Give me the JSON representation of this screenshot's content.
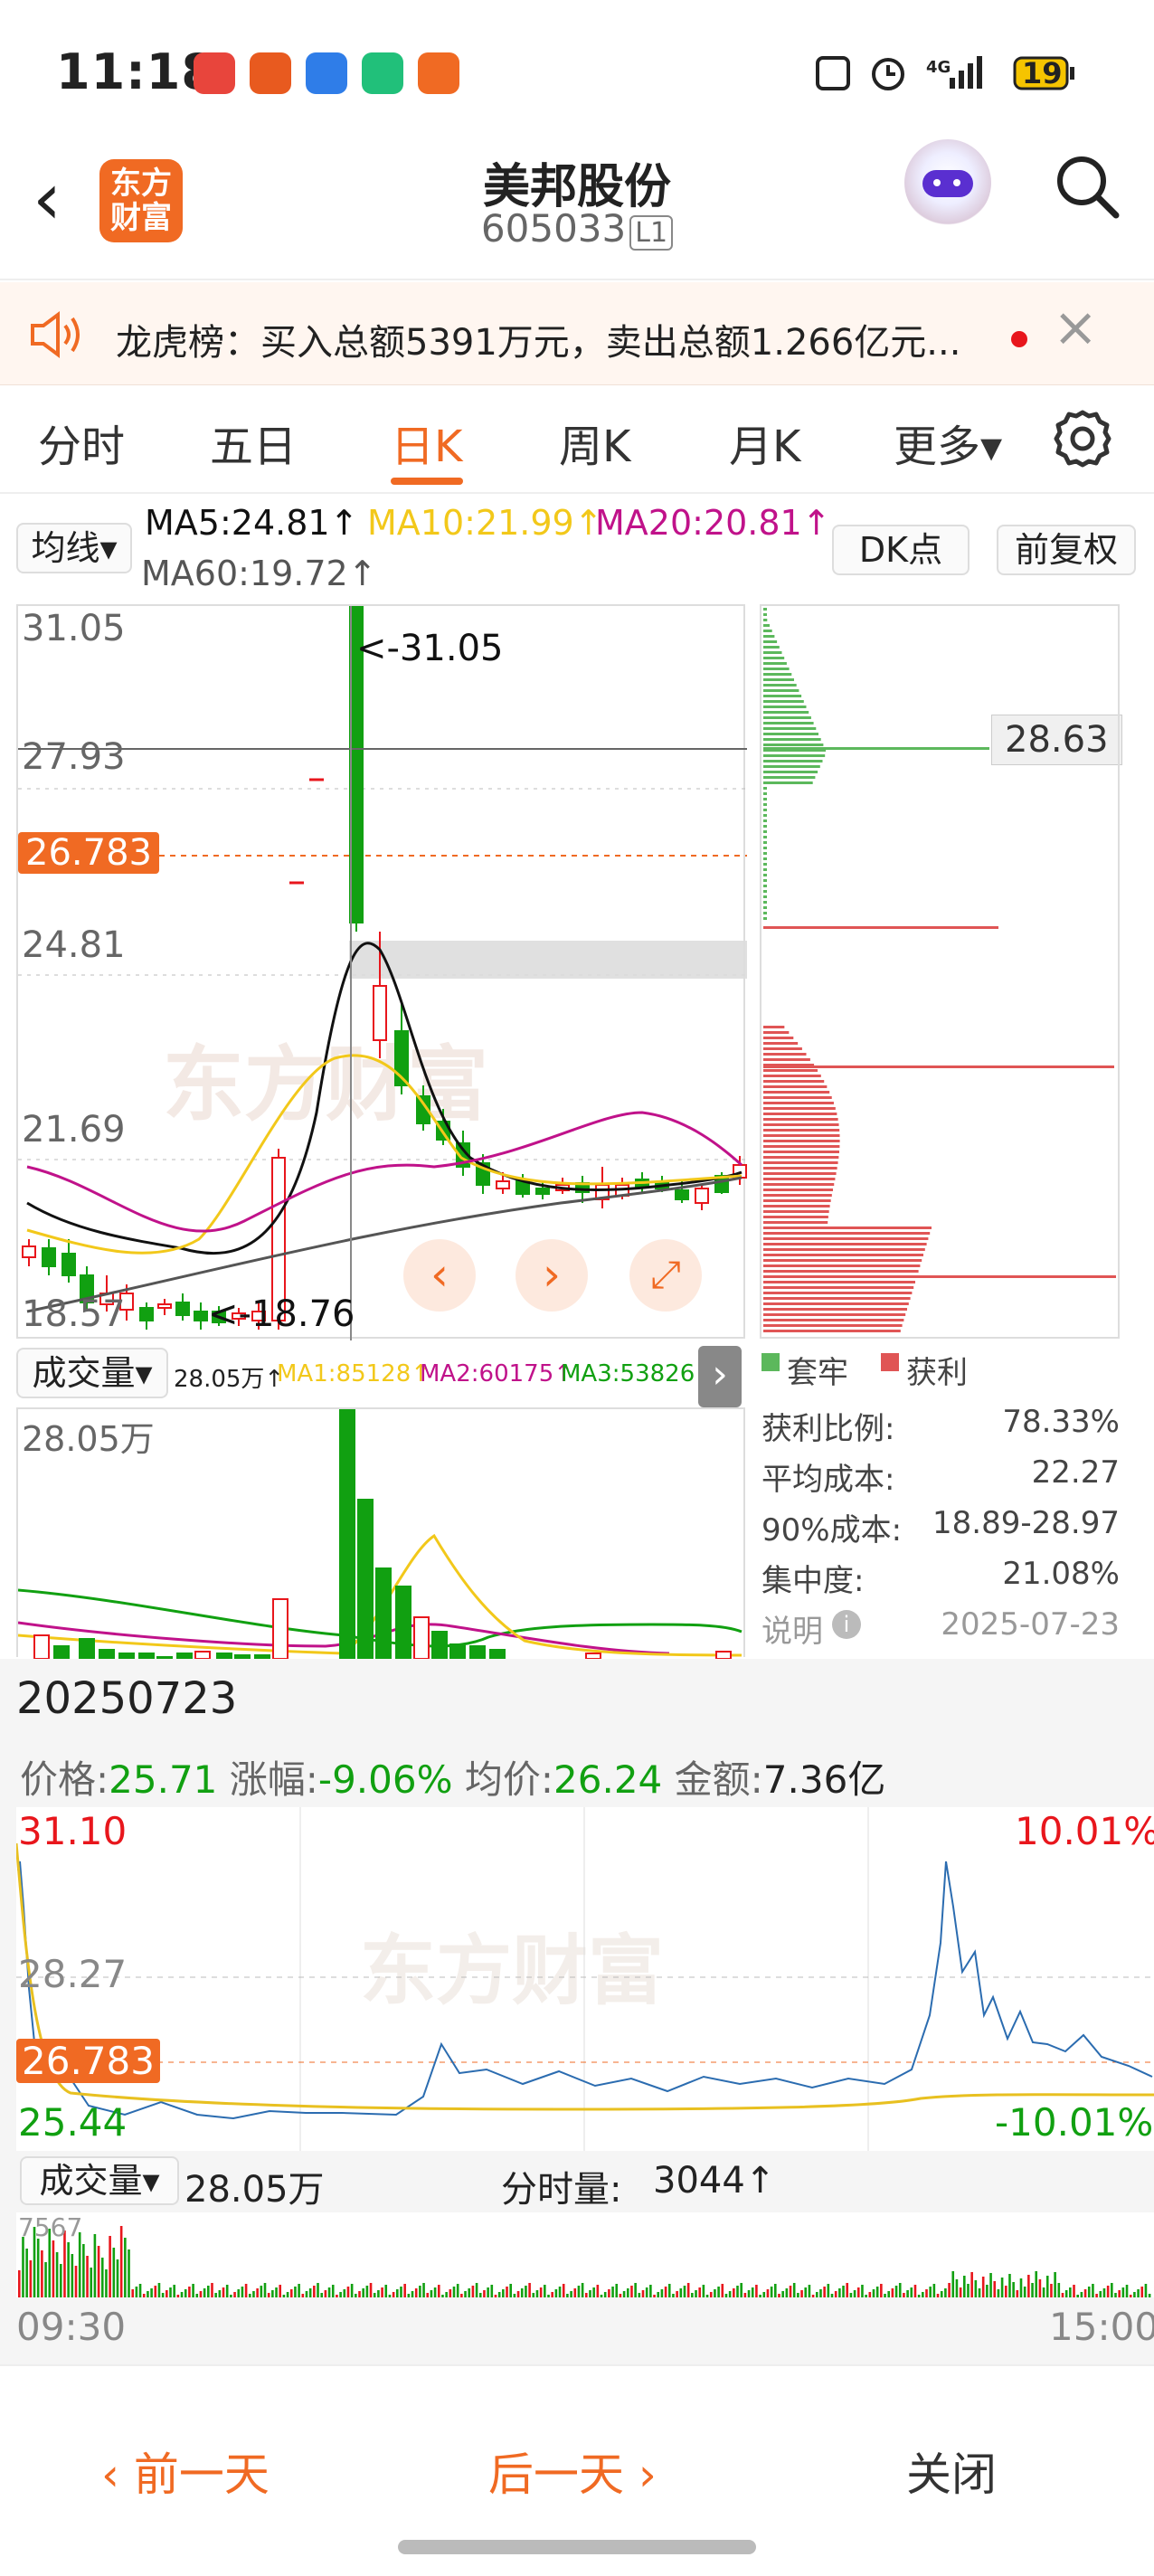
{
  "status": {
    "time": "11:18",
    "battery": "19",
    "network": "4G"
  },
  "header": {
    "title": "美邦股份",
    "code": "605033",
    "code_badge": "L1",
    "logo_line1": "东方",
    "logo_line2": "财富"
  },
  "notice": {
    "text": "龙虎榜：买入总额5391万元，卖出总额1.266亿元..."
  },
  "tabs": [
    "分时",
    "五日",
    "日K",
    "周K",
    "月K",
    "更多▾"
  ],
  "active_tab": "日K",
  "ma": {
    "selector": "均线▾",
    "ma5": "MA5:24.81↑",
    "ma10": "MA10:21.99↑",
    "ma20": "MA20:20.81↑",
    "ma60": "MA60:19.72↑",
    "dk_button": "DK点",
    "fq_button": "前复权"
  },
  "kchart": {
    "y_labels": [
      "31.05",
      "27.93",
      "24.81",
      "21.69",
      "18.57"
    ],
    "high_label": "<-31.05",
    "low_label": "<-18.76",
    "current_price_tag": "26.783",
    "crosshair_price": "28.63"
  },
  "volume": {
    "selector": "成交量▾",
    "value": "28.05万↑",
    "ma1": "MA1:85128↑",
    "ma2": "MA2:60175↑",
    "ma3": "MA3:53826↑",
    "y_label": "28.05万"
  },
  "chip": {
    "legend_trapped": "套牢",
    "legend_profit": "获利",
    "rows": [
      {
        "label": "获利比例:",
        "value": "78.33%"
      },
      {
        "label": "平均成本:",
        "value": "22.27"
      },
      {
        "label": "90%成本:",
        "value": "18.89-28.97"
      },
      {
        "label": "集中度:",
        "value": "21.08%"
      },
      {
        "label": "说明",
        "value": "2025-07-23"
      }
    ]
  },
  "detail": {
    "date": "20250723",
    "price_label": "价格:",
    "price": "25.71",
    "change_label": "涨幅:",
    "change": "-9.06%",
    "avg_label": "均价:",
    "avg": "26.24",
    "amount_label": "金额:",
    "amount": "7.36亿"
  },
  "tchart": {
    "top": "31.10",
    "mid": "28.27",
    "tag": "26.783",
    "bottom": "25.44",
    "up_pct": "10.01%",
    "down_pct": "-10.01%",
    "vol_selector": "成交量▾",
    "vol_value": "28.05万",
    "tick_label": "分时量:",
    "tick_value": "3044↑",
    "vol_top": "7567",
    "start_time": "09:30",
    "end_time": "15:00"
  },
  "bottom": {
    "prev": "‹ 前一天",
    "next": "后一天 ›",
    "close": "关闭"
  },
  "colors": {
    "accent": "#f06a23",
    "up": "#e8161c",
    "down": "#11a011",
    "ma5": "#111111",
    "ma10": "#f2c81a",
    "ma20": "#c0128a",
    "ma60": "#555555"
  }
}
